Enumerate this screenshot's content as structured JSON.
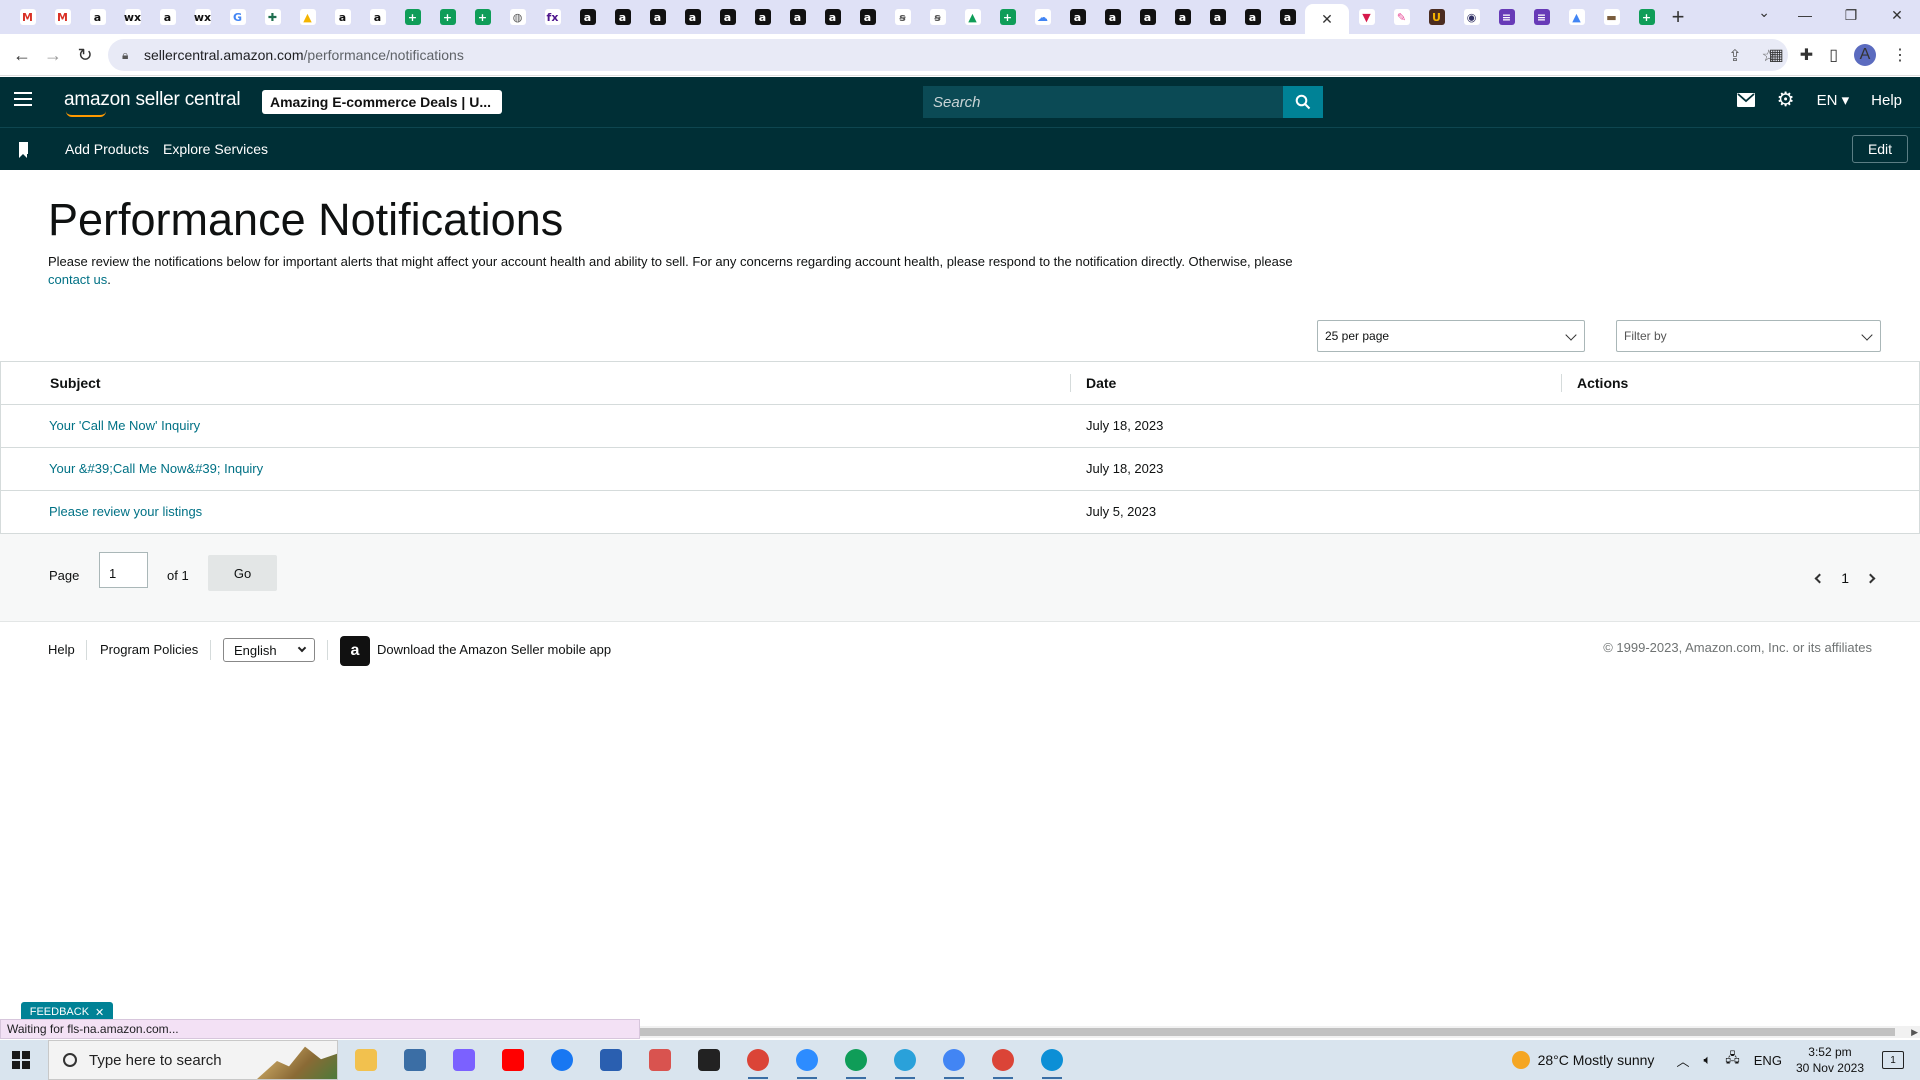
{
  "browser": {
    "address": {
      "domain": "sellercentral.amazon.com",
      "path": "/performance/notifications"
    },
    "tab_favicons": [
      {
        "name": "gmail-icon",
        "glyph": "M",
        "bg": "#ffffff",
        "fg": "#d93025"
      },
      {
        "name": "gmail-icon",
        "glyph": "M",
        "bg": "#ffffff",
        "fg": "#d93025"
      },
      {
        "name": "amazon-icon",
        "glyph": "a",
        "bg": "#ffffff",
        "fg": "#111111"
      },
      {
        "name": "wix-icon",
        "glyph": "wx",
        "bg": "#ffffff",
        "fg": "#111111"
      },
      {
        "name": "amazon-icon",
        "glyph": "a",
        "bg": "#ffffff",
        "fg": "#111111"
      },
      {
        "name": "wix-icon",
        "glyph": "wx",
        "bg": "#ffffff",
        "fg": "#111111"
      },
      {
        "name": "google-icon",
        "glyph": "G",
        "bg": "#ffffff",
        "fg": "#4285f4"
      },
      {
        "name": "puzzle-icon",
        "glyph": "✚",
        "bg": "#ffffff",
        "fg": "#1e6e4e"
      },
      {
        "name": "drive-icon",
        "glyph": "▲",
        "bg": "#ffffff",
        "fg": "#f4b400"
      },
      {
        "name": "amazon-icon",
        "glyph": "a",
        "bg": "#ffffff",
        "fg": "#111111"
      },
      {
        "name": "amazon-icon",
        "glyph": "a",
        "bg": "#ffffff",
        "fg": "#111111"
      },
      {
        "name": "sheets-icon",
        "glyph": "+",
        "bg": "#0f9d58",
        "fg": "#ffffff"
      },
      {
        "name": "sheets-icon",
        "glyph": "+",
        "bg": "#0f9d58",
        "fg": "#ffffff"
      },
      {
        "name": "sheets-icon",
        "glyph": "+",
        "bg": "#0f9d58",
        "fg": "#ffffff"
      },
      {
        "name": "globe-icon",
        "glyph": "◍",
        "bg": "#ffffff",
        "fg": "#555555"
      },
      {
        "name": "fedex-icon",
        "glyph": "fx",
        "bg": "#ffffff",
        "fg": "#4d148c"
      },
      {
        "name": "amazon-icon",
        "glyph": "a",
        "bg": "#111111",
        "fg": "#ffffff"
      },
      {
        "name": "amazon-icon",
        "glyph": "a",
        "bg": "#111111",
        "fg": "#ffffff"
      },
      {
        "name": "amazon-icon",
        "glyph": "a",
        "bg": "#111111",
        "fg": "#ffffff"
      },
      {
        "name": "amazon-icon",
        "glyph": "a",
        "bg": "#111111",
        "fg": "#ffffff"
      },
      {
        "name": "amazon-icon",
        "glyph": "a",
        "bg": "#111111",
        "fg": "#ffffff"
      },
      {
        "name": "amazon-icon",
        "glyph": "a",
        "bg": "#111111",
        "fg": "#ffffff"
      },
      {
        "name": "amazon-icon",
        "glyph": "a",
        "bg": "#111111",
        "fg": "#ffffff"
      },
      {
        "name": "amazon-icon",
        "glyph": "a",
        "bg": "#111111",
        "fg": "#ffffff"
      },
      {
        "name": "amazon-icon",
        "glyph": "a",
        "bg": "#111111",
        "fg": "#ffffff"
      },
      {
        "name": "script-icon",
        "glyph": "ꞩ",
        "bg": "#ffffff",
        "fg": "#555555"
      },
      {
        "name": "script-icon",
        "glyph": "ꞩ",
        "bg": "#ffffff",
        "fg": "#555555"
      },
      {
        "name": "drive-icon",
        "glyph": "▲",
        "bg": "#ffffff",
        "fg": "#0f9d58"
      },
      {
        "name": "sheets-icon",
        "glyph": "+",
        "bg": "#0f9d58",
        "fg": "#ffffff"
      },
      {
        "name": "cloud-icon",
        "glyph": "☁",
        "bg": "#ffffff",
        "fg": "#4285f4"
      },
      {
        "name": "amazon-icon",
        "glyph": "a",
        "bg": "#111111",
        "fg": "#ffffff"
      },
      {
        "name": "amazon-icon",
        "glyph": "a",
        "bg": "#111111",
        "fg": "#ffffff"
      },
      {
        "name": "amazon-icon",
        "glyph": "a",
        "bg": "#111111",
        "fg": "#ffffff"
      },
      {
        "name": "amazon-icon",
        "glyph": "a",
        "bg": "#111111",
        "fg": "#ffffff"
      },
      {
        "name": "amazon-icon",
        "glyph": "a",
        "bg": "#111111",
        "fg": "#ffffff"
      },
      {
        "name": "amazon-icon",
        "glyph": "a",
        "bg": "#111111",
        "fg": "#ffffff"
      },
      {
        "name": "amazon-icon",
        "glyph": "a",
        "bg": "#111111",
        "fg": "#ffffff"
      }
    ],
    "tab_favicons_after": [
      {
        "name": "vee-icon",
        "glyph": "▼",
        "bg": "#ffffff",
        "fg": "#d6194b"
      },
      {
        "name": "pencil-icon",
        "glyph": "✎",
        "bg": "#ffffff",
        "fg": "#e84393"
      },
      {
        "name": "ups-icon",
        "glyph": "U",
        "bg": "#4b2c20",
        "fg": "#f5b400"
      },
      {
        "name": "usps-icon",
        "glyph": "◉",
        "bg": "#ffffff",
        "fg": "#333366"
      },
      {
        "name": "forms-icon",
        "glyph": "≡",
        "bg": "#673ab7",
        "fg": "#ffffff"
      },
      {
        "name": "forms-icon",
        "glyph": "≡",
        "bg": "#673ab7",
        "fg": "#ffffff"
      },
      {
        "name": "drive-icon",
        "glyph": "▲",
        "bg": "#ffffff",
        "fg": "#4285f4"
      },
      {
        "name": "store-icon",
        "glyph": "▬",
        "bg": "#ffffff",
        "fg": "#7a5c3c"
      },
      {
        "name": "sheets-icon",
        "glyph": "+",
        "bg": "#0f9d58",
        "fg": "#ffffff"
      }
    ]
  },
  "header": {
    "logo_text": "amazon seller central",
    "store": "Amazing E-commerce Deals | U...",
    "search_placeholder": "Search",
    "lang": "EN",
    "help": "Help"
  },
  "subnav": {
    "add_products": "Add Products",
    "explore_services": "Explore Services",
    "edit": "Edit"
  },
  "page": {
    "title": "Performance Notifications",
    "intro_text": "Please review the notifications below for important alerts that might affect your account health and ability to sell. For any concerns regarding account health, please respond to the notification directly. Otherwise, please ",
    "contact_link": "contact us",
    "intro_end": "."
  },
  "controls": {
    "per_page": "25 per page",
    "filter": "Filter by"
  },
  "table": {
    "columns": [
      "Subject",
      "Date",
      "Actions"
    ],
    "rows": [
      {
        "subject": "Your 'Call Me Now' Inquiry",
        "date": "July 18, 2023"
      },
      {
        "subject": "Your &#39;Call Me Now&#39; Inquiry",
        "date": "July 18, 2023"
      },
      {
        "subject": "Please review your listings",
        "date": "July 5, 2023"
      }
    ]
  },
  "pager": {
    "page_label": "Page",
    "page_value": "1",
    "of_label": "of 1",
    "go": "Go",
    "current": "1"
  },
  "footer": {
    "help": "Help",
    "program_policies": "Program Policies",
    "language": "English",
    "app_text": "Download the Amazon Seller mobile app",
    "copyright": "© 1999-2023, Amazon.com, Inc. or its affiliates"
  },
  "feedback": "FEEDBACK",
  "status": "Waiting for fls-na.amazon.com...",
  "taskbar": {
    "search": "Type here to search",
    "weather": "28°C  Mostly sunny",
    "lang": "ENG",
    "time": "3:52 pm",
    "date": "30 Nov 2023",
    "notifications": "1",
    "apps": [
      {
        "name": "file-explorer-icon",
        "color": "#f2c14e"
      },
      {
        "name": "calculator-icon",
        "color": "#3b6ea5"
      },
      {
        "name": "copilot-icon",
        "color": "#7b61ff"
      },
      {
        "name": "youtube-icon",
        "color": "#ff0000"
      },
      {
        "name": "facebook-icon",
        "color": "#1877f2"
      },
      {
        "name": "store-icon",
        "color": "#2a5fb0"
      },
      {
        "name": "snipping-icon",
        "color": "#d9534f"
      },
      {
        "name": "sticky-notes-icon",
        "color": "#222222"
      },
      {
        "name": "chrome-icon",
        "color": "#db4437"
      },
      {
        "name": "zoom-icon",
        "color": "#2d8cff"
      },
      {
        "name": "chrome-icon",
        "color": "#0f9d58"
      },
      {
        "name": "telegram-icon",
        "color": "#2aa1da"
      },
      {
        "name": "chrome-icon",
        "color": "#4285f4"
      },
      {
        "name": "chrome-icon",
        "color": "#db4437"
      },
      {
        "name": "edge-icon",
        "color": "#0c8fd6"
      }
    ]
  }
}
